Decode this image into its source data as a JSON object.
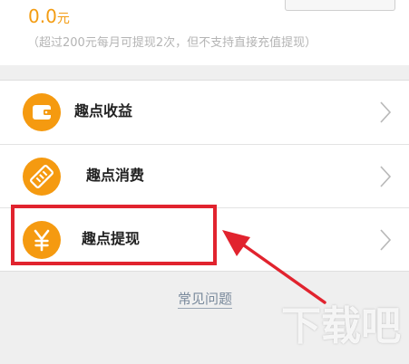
{
  "balance": {
    "amount": "0.0",
    "unit": "元"
  },
  "withdraw_note": "（超过200元每月可提现2次，但不支持直接充值提现）",
  "menu": {
    "items": [
      {
        "label": "趣点收益",
        "icon": "wallet-icon"
      },
      {
        "label": "趣点消费",
        "icon": "ticket-icon"
      },
      {
        "label": "趣点提现",
        "icon": "yuan-icon"
      }
    ]
  },
  "faq_link": "常见问题",
  "watermark": "下载吧",
  "colors": {
    "accent": "#f59a10",
    "balance_text": "#f39c12",
    "highlight": "#e1232e",
    "link": "#7a8a9c"
  }
}
